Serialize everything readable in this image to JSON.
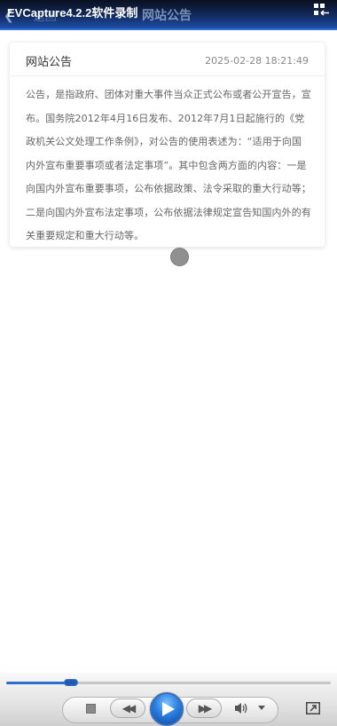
{
  "overlay": {
    "title": "EVCapture4.2.2软件录制"
  },
  "nav": {
    "back_label": "返回",
    "title": "网站公告",
    "icons": {
      "back": "chevron-left-icon",
      "menu": "grid-collapse-icon"
    }
  },
  "announcement": {
    "title": "网站公告",
    "date": "2025-02-28 18:21:49",
    "body": "公告，是指政府、团体对重大事件当众正式公布或者公开宣告，宣布。国务院2012年4月16日发布、2012年7月1日起施行的《党政机关公文处理工作条例》，对公告的使用表述为：“适用于向国内外宣布重要事项或者法定事项”。其中包含两方面的内容：一是向国内外宣布重要事项，公布依据政策、法令采取的重大行动等；二是向国内外宣布法定事项，公布依据法律规定宣告知国内外的有关重要规定和重大行动等。"
  },
  "player": {
    "progress": 0.2,
    "accent": "#2a6fc9",
    "icons": {
      "stop": "stop-icon",
      "previous": "rewind-icon",
      "play": "play-icon",
      "next": "fast-forward-icon",
      "volume": "speaker-icon",
      "volume_menu": "chevron-down-icon",
      "expand": "expand-icon"
    }
  }
}
